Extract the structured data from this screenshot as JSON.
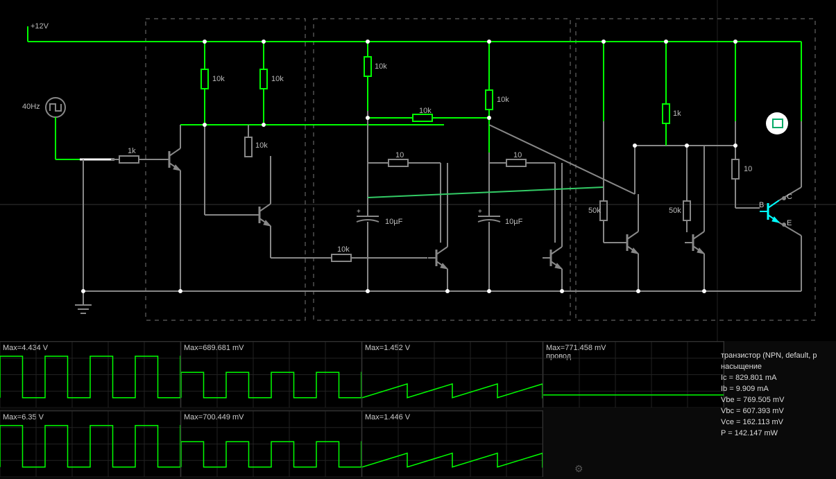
{
  "rail_label": "+12V",
  "source_freq": "40Hz",
  "components": {
    "r_in": "1k",
    "r_q1c": "10k",
    "r_q2b": "10k",
    "r_q2e": "10k",
    "r_top3": "10k",
    "r_mid3": "10k",
    "r_top4": "10k",
    "r_e3": "10",
    "r_e4": "10",
    "r_fb": "10k",
    "r_b5": "50k",
    "r_b6": "50k",
    "r_out_top": "1k",
    "r_out_e": "10",
    "c1": "10µF",
    "c2": "10µF"
  },
  "probe": {
    "b": "B",
    "c": "C",
    "e": "E"
  },
  "scopes": [
    {
      "title": "Max=4.434 V",
      "shape": "square",
      "amp": 0.9
    },
    {
      "title": "Max=689.681 mV",
      "shape": "square",
      "amp": 0.55
    },
    {
      "title": "Max=1.452 V",
      "shape": "saw",
      "amp": 0.3
    },
    {
      "title": "Max=771.458 mV\nпровод",
      "shape": "flat",
      "amp": 0.06
    },
    {
      "title": "Max=6.35 V",
      "shape": "square",
      "amp": 0.9
    },
    {
      "title": "Max=700.449 mV",
      "shape": "square",
      "amp": 0.55
    },
    {
      "title": "Max=1.446 V",
      "shape": "saw",
      "amp": 0.3
    }
  ],
  "info": {
    "l1": "транзистор (NPN, default, p",
    "l2": "насыщение",
    "l3": "Ic = 829.801 mA",
    "l4": "Ib = 9.909 mA",
    "l5": "Vbe = 769.505 mV",
    "l6": "Vbc = 607.393 mV",
    "l7": "Vce = 162.113 mV",
    "l8": "P = 142.147 mW"
  }
}
